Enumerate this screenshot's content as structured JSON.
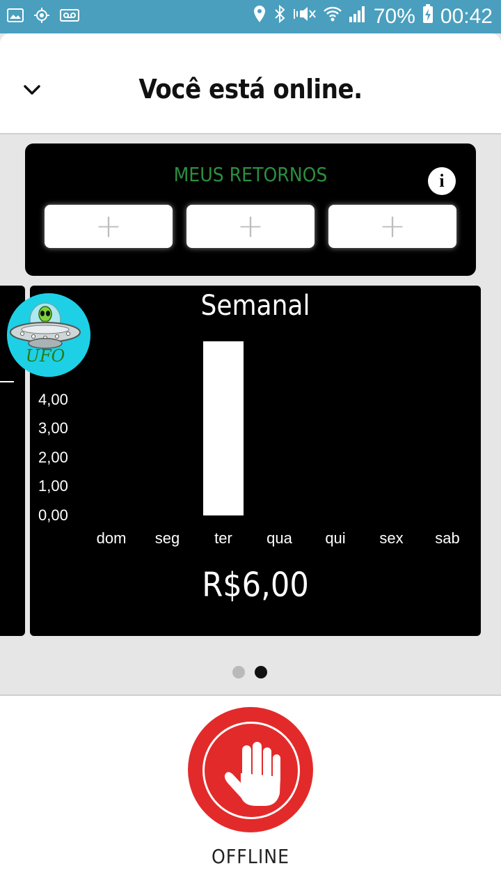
{
  "status_bar": {
    "battery": "70%",
    "time": "00:42",
    "icons": [
      "image-icon",
      "gps-icon",
      "voicemail-icon",
      "location-icon",
      "bluetooth-icon",
      "mute-icon",
      "wifi-icon",
      "signal-icon",
      "battery-icon"
    ]
  },
  "header": {
    "title": "Você está online."
  },
  "retornos": {
    "title": "MEUS RETORNOS",
    "info_label": "i",
    "slots": [
      "+",
      "+",
      "+"
    ]
  },
  "avatar": {
    "label": "UFO"
  },
  "chart_data": {
    "type": "bar",
    "title": "Semanal",
    "categories": [
      "dom",
      "seg",
      "ter",
      "qua",
      "qui",
      "sex",
      "sab"
    ],
    "values": [
      0,
      0,
      6,
      0,
      0,
      0,
      0
    ],
    "y_ticks": [
      "0,00",
      "1,00",
      "2,00",
      "3,00",
      "4,00"
    ],
    "ylim": [
      0,
      6
    ],
    "total": "R$6,00",
    "colors": {
      "bar": "#ffffff",
      "background": "#000000"
    }
  },
  "pager": {
    "count": 2,
    "active_index": 1,
    "colors": {
      "active": "#111111",
      "inactive": "#b9b9b9"
    }
  },
  "bottom": {
    "offline_label": "OFFLINE",
    "button_icon": "hand-stop-icon",
    "button_color": "#e32a2a"
  }
}
